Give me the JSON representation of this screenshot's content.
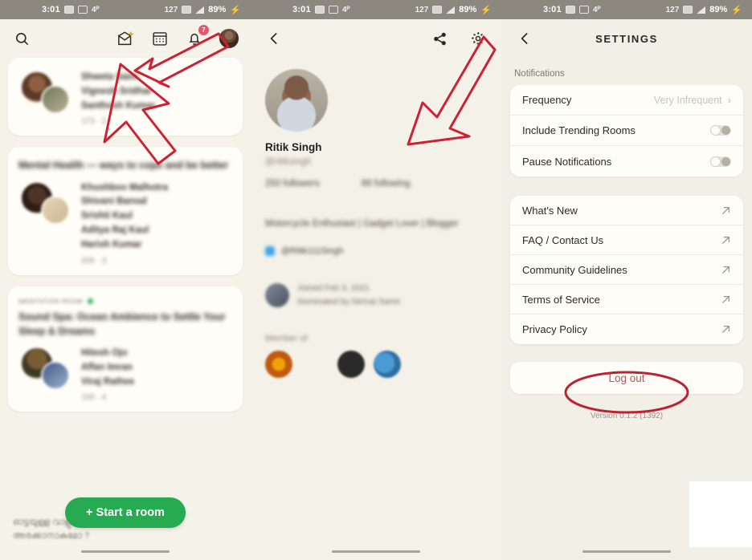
{
  "statusbar": {
    "time": "3:01",
    "battery": "89%",
    "net": "127",
    "icons": [
      "image-icon",
      "screenshot-icon",
      "nfc-icon",
      "vpn-icon",
      "alarm-icon",
      "signal-icon",
      "charging-bolt-icon"
    ]
  },
  "home": {
    "toolbar": {
      "search": "search-icon",
      "invite": "envelope-sparkle-icon",
      "calendar": "calendar-icon",
      "bell": "bell-icon",
      "bell_badge": "7",
      "avatar": "profile-avatar"
    },
    "cards": [
      {
        "topic": "",
        "title": "",
        "live": false,
        "speakers": [
          "Shweta Saini",
          "Vignesh Sridhar",
          "Santhosh Kumar"
        ],
        "meta": "173  ·  2"
      },
      {
        "topic": "",
        "title": "Mental Health — ways to cope and be better",
        "live": false,
        "speakers": [
          "Khushboo Malhotra",
          "Shivani Bansal",
          "Srishti Kaul",
          "Aditya Raj Kaul",
          "Harish Kumar"
        ],
        "meta": "205  ·  3"
      },
      {
        "topic": "MEDITATION ROOM",
        "title": "Sound Spa: Ocean Ambience to Settle Your Sleep & Dreams",
        "live": true,
        "speakers": [
          "Hitesh Ojo",
          "Affan Imran",
          "Viraj Rathee"
        ],
        "meta": "100  ·  4"
      }
    ],
    "start_room_label": "+ Start a room",
    "footer_text_line1": "ഓട്ടയുള്ള വാളുകൊണ്ട്",
    "footer_text_line2": "അരക്കാനാകുമോ ?"
  },
  "profile": {
    "toolbar": {
      "back": "back-chevron-icon",
      "share": "share-icon",
      "settings": "gear-icon"
    },
    "name": "Ritik Singh",
    "handle": "@ritiksingh",
    "followers": "250 followers",
    "following": "88 following",
    "bio": "Motorcycle Enthusiast | Gadget Lover | Blogger",
    "twitter": "@Ritik111Singh",
    "joined": "Joined Feb 3, 2021",
    "nominated": "Nominated by Nirmal Samir",
    "member_of_label": "Member of",
    "member_clubs": [
      "club-avatar-1",
      "club-avatar-2",
      "club-avatar-3",
      "club-avatar-4"
    ]
  },
  "settings": {
    "back": "back-chevron-icon",
    "title": "SETTINGS",
    "notifications_label": "Notifications",
    "notification_rows": [
      {
        "label": "Frequency",
        "type": "value",
        "value": "Very Infrequent",
        "chevron": "›"
      },
      {
        "label": "Include Trending Rooms",
        "type": "toggle",
        "on": false
      },
      {
        "label": "Pause Notifications",
        "type": "toggle",
        "on": false
      }
    ],
    "links": [
      {
        "label": "What's New",
        "icon": "external-link-icon"
      },
      {
        "label": "FAQ / Contact Us",
        "icon": "external-link-icon"
      },
      {
        "label": "Community Guidelines",
        "icon": "external-link-icon"
      },
      {
        "label": "Terms of Service",
        "icon": "external-link-icon"
      },
      {
        "label": "Privacy Policy",
        "icon": "external-link-icon"
      }
    ],
    "logout_label": "Log out",
    "version": "Version 0.1.2 (1392)"
  },
  "annotations": {
    "color": "#cc2233",
    "shapes": [
      "arrow-to-profile-avatar",
      "arrow-to-settings-gear",
      "ellipse-around-logout"
    ]
  }
}
